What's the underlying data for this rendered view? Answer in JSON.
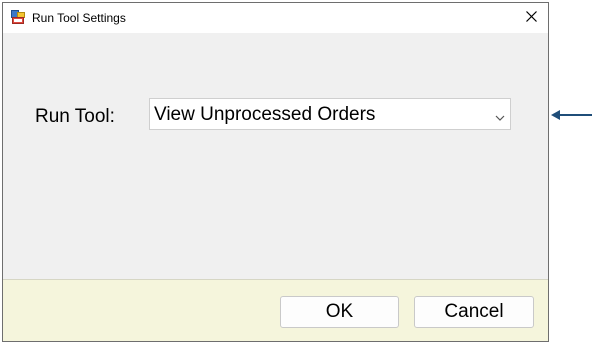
{
  "window": {
    "title": "Run Tool Settings",
    "icon": "app-window-icon",
    "close_icon": "close-icon"
  },
  "form": {
    "run_tool_label": "Run Tool:",
    "run_tool_value": "View Unprocessed Orders",
    "dropdown_icon": "chevron-down-icon"
  },
  "buttons": {
    "ok_label": "OK",
    "cancel_label": "Cancel"
  },
  "annotation": {
    "icon": "arrow-left-icon",
    "color": "#1f4e79"
  },
  "colors": {
    "dialog_bg": "#f0f0f0",
    "footer_bg": "#f5f5dc",
    "titlebar_bg": "#ffffff"
  }
}
